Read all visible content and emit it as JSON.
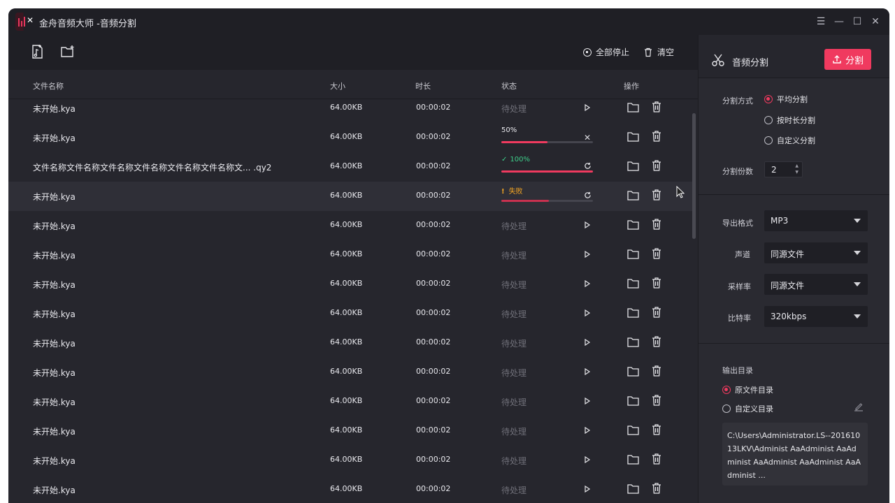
{
  "app": {
    "title": "金舟音频大师 -音频分割",
    "accent": "#f03a5f"
  },
  "window_controls": [
    "menu-icon",
    "minimize-icon",
    "maximize-icon",
    "close-icon"
  ],
  "toolbar": {
    "add_file_icon": "add-music-file-icon",
    "add_folder_icon": "add-folder-icon",
    "stop_all_label": "全部停止",
    "clear_label": "清空"
  },
  "table": {
    "headers": {
      "name": "文件名称",
      "size": "大小",
      "duration": "时长",
      "status": "状态",
      "actions": "操作"
    },
    "rows": [
      {
        "name": "未开始.kya",
        "size": "64.00KB",
        "duration": "00:00:02",
        "status": "待处理",
        "kind": "pending"
      },
      {
        "name": "未开始.kya",
        "size": "64.00KB",
        "duration": "00:00:02",
        "status": "50%",
        "kind": "progress",
        "progress": 0.5
      },
      {
        "name": "文件名称文件名称文件名称文件名称文件名称文件名称文... .qy2",
        "size": "64.00KB",
        "duration": "00:00:02",
        "status": "100%",
        "kind": "done",
        "progress": 1.0
      },
      {
        "name": "未开始.kya",
        "size": "64.00KB",
        "duration": "00:00:02",
        "status": "失败",
        "kind": "failed",
        "progress": 0.52
      },
      {
        "name": "未开始.kya",
        "size": "64.00KB",
        "duration": "00:00:02",
        "status": "待处理",
        "kind": "pending"
      },
      {
        "name": "未开始.kya",
        "size": "64.00KB",
        "duration": "00:00:02",
        "status": "待处理",
        "kind": "pending"
      },
      {
        "name": "未开始.kya",
        "size": "64.00KB",
        "duration": "00:00:02",
        "status": "待处理",
        "kind": "pending"
      },
      {
        "name": "未开始.kya",
        "size": "64.00KB",
        "duration": "00:00:02",
        "status": "待处理",
        "kind": "pending"
      },
      {
        "name": "未开始.kya",
        "size": "64.00KB",
        "duration": "00:00:02",
        "status": "待处理",
        "kind": "pending"
      },
      {
        "name": "未开始.kya",
        "size": "64.00KB",
        "duration": "00:00:02",
        "status": "待处理",
        "kind": "pending"
      },
      {
        "name": "未开始.kya",
        "size": "64.00KB",
        "duration": "00:00:02",
        "status": "待处理",
        "kind": "pending"
      },
      {
        "name": "未开始.kya",
        "size": "64.00KB",
        "duration": "00:00:02",
        "status": "待处理",
        "kind": "pending"
      },
      {
        "name": "未开始.kya",
        "size": "64.00KB",
        "duration": "00:00:02",
        "status": "待处理",
        "kind": "pending"
      },
      {
        "name": "未开始.kya",
        "size": "64.00KB",
        "duration": "00:00:02",
        "status": "待处理",
        "kind": "pending"
      }
    ]
  },
  "panel": {
    "title": "音频分割",
    "split_button": "分割",
    "split_mode_label": "分割方式",
    "split_modes": [
      {
        "label": "平均分割",
        "selected": true
      },
      {
        "label": "按时长分割",
        "selected": false
      },
      {
        "label": "自定义分割",
        "selected": false
      }
    ],
    "split_count_label": "分割份数",
    "split_count": "2",
    "format_label": "导出格式",
    "format": "MP3",
    "channel_label": "声道",
    "channel": "同源文件",
    "samplerate_label": "采样率",
    "samplerate": "同源文件",
    "bitrate_label": "比特率",
    "bitrate": "320kbps",
    "output_label": "输出目录",
    "output_options": [
      {
        "label": "原文件目录",
        "selected": true
      },
      {
        "label": "自定义目录",
        "selected": false
      }
    ],
    "output_path": "C:\\Users\\Administrator.LS--20161013LKV\\Administ AaAdminist AaAdminist AaAdminist AaAdminist AaAdminist ..."
  }
}
